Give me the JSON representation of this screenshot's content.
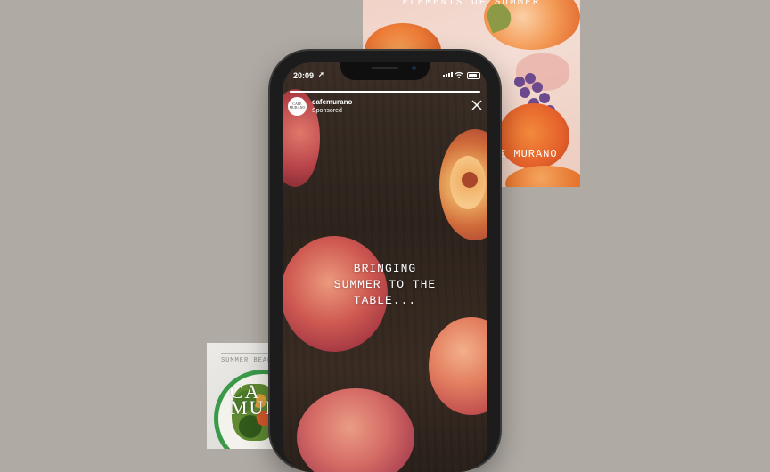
{
  "background": {
    "color": "#b0aaa4",
    "poster_right": {
      "heading": "ELEMENTS OF SUMMER",
      "footer": "E MURANO"
    },
    "poster_left": {
      "tag": "SUMMER BEAN",
      "logo": "CA\nMUR"
    }
  },
  "phone": {
    "status_bar": {
      "time": "20:09",
      "location_icon": "location-arrow-icon",
      "icons": [
        "signal-icon",
        "wifi-icon",
        "battery-icon"
      ]
    },
    "story": {
      "progress_fraction": 1.0,
      "account": {
        "avatar_text": "CAFE MURANO",
        "name": "cafemurano",
        "label": "Sponsored"
      },
      "close_icon": "close-icon",
      "caption": "BRINGING\nSUMMER TO THE\nTABLE..."
    }
  }
}
